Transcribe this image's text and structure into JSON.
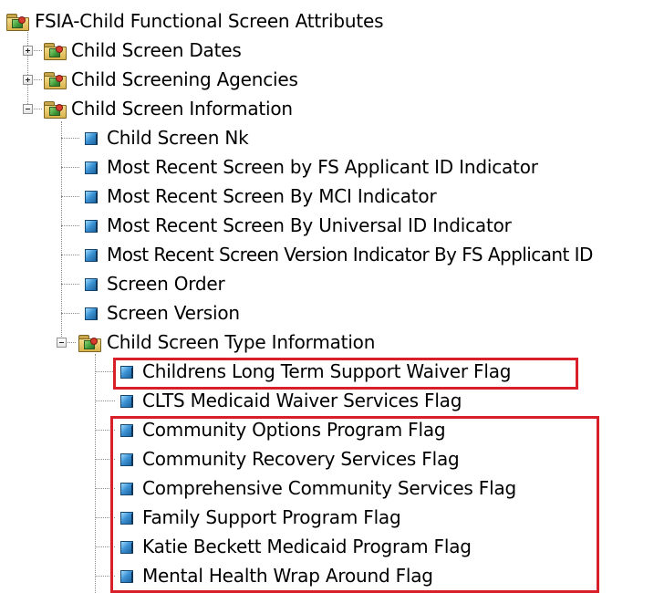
{
  "colors": {
    "highlight": "#d9202a",
    "connector": "#8a8a8a",
    "attribute_icon": "#3c93d4",
    "folder_icon": "#e0bd5a"
  },
  "tree": {
    "root": {
      "label": "FSIA-Child Functional Screen Attributes",
      "icon": "folder-icon"
    },
    "folders": [
      {
        "label": "Child Screen Dates",
        "state": "collapsed",
        "icon": "folder-icon"
      },
      {
        "label": "Child Screening Agencies",
        "state": "collapsed",
        "icon": "folder-icon"
      },
      {
        "label": "Child Screen Information",
        "state": "expanded",
        "icon": "folder-icon"
      }
    ],
    "info_items": [
      {
        "label": "Child Screen Nk",
        "icon": "attribute-icon"
      },
      {
        "label": "Most Recent Screen by FS Applicant ID Indicator",
        "icon": "attribute-icon"
      },
      {
        "label": "Most Recent Screen By MCI Indicator",
        "icon": "attribute-icon"
      },
      {
        "label": "Most Recent Screen By Universal ID Indicator",
        "icon": "attribute-icon"
      },
      {
        "label": "Most Recent Screen Version Indicator By FS Applicant ID",
        "icon": "attribute-icon"
      },
      {
        "label": "Screen Order",
        "icon": "attribute-icon"
      },
      {
        "label": "Screen Version",
        "icon": "attribute-icon"
      }
    ],
    "type_folder": {
      "label": "Child Screen Type Information",
      "state": "expanded",
      "icon": "folder-icon"
    },
    "type_items": [
      {
        "label": "Childrens Long Term Support Waiver Flag",
        "icon": "attribute-icon",
        "highlighted": true
      },
      {
        "label": "CLTS Medicaid Waiver Services Flag",
        "icon": "attribute-icon",
        "highlighted": false
      },
      {
        "label": "Community Options Program Flag",
        "icon": "attribute-icon",
        "highlighted": true
      },
      {
        "label": "Community Recovery Services Flag",
        "icon": "attribute-icon",
        "highlighted": true
      },
      {
        "label": "Comprehensive Community Services Flag",
        "icon": "attribute-icon",
        "highlighted": true
      },
      {
        "label": "Family Support Program Flag",
        "icon": "attribute-icon",
        "highlighted": true
      },
      {
        "label": "Katie Beckett Medicaid Program Flag",
        "icon": "attribute-icon",
        "highlighted": true
      },
      {
        "label": "Mental Health Wrap Around Flag",
        "icon": "attribute-icon",
        "highlighted": true
      }
    ]
  }
}
